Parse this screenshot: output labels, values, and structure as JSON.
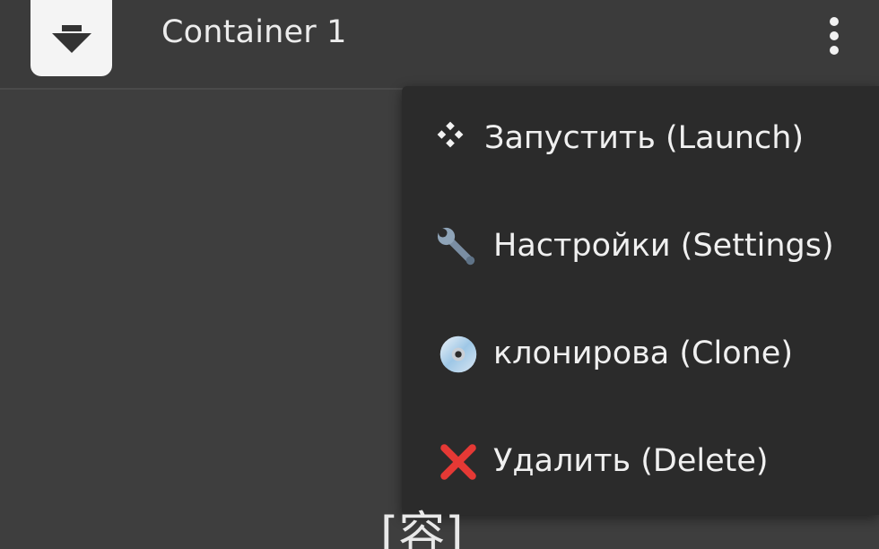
{
  "header": {
    "title": "Container 1",
    "app_icon": "download-box-icon",
    "menu_icon": "more-vertical-icon"
  },
  "menu": {
    "items": [
      {
        "icon": "diamond-cluster-icon",
        "label": "Запустить (Launch)"
      },
      {
        "icon": "wrench-icon",
        "label": "Настройки (Settings)"
      },
      {
        "icon": "disc-icon",
        "label": "клонирова (Clone)"
      },
      {
        "icon": "red-cross-icon",
        "label": "Удалить (Delete)"
      }
    ]
  },
  "footer": {
    "partial_text": "[容]"
  },
  "colors": {
    "background": "#3e3e3e",
    "menu_background": "#2b2b2b",
    "text": "#f0f0f0",
    "delete_red": "#e53935"
  }
}
